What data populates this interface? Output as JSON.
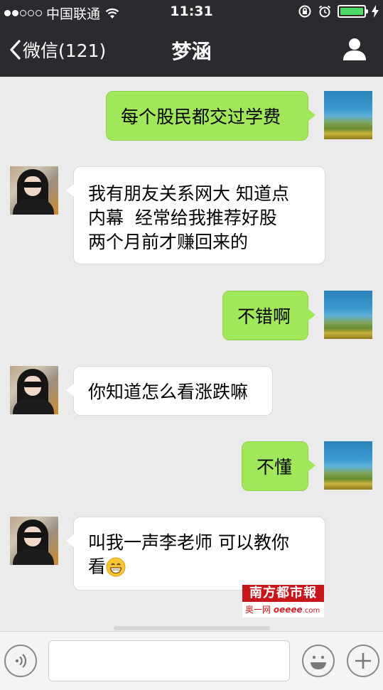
{
  "status_bar": {
    "carrier": "中国联通",
    "time": "11:31",
    "battery_level": 1.0,
    "icons": [
      "signal-dots-icon",
      "wifi-icon",
      "orientation-lock-icon",
      "alarm-icon",
      "battery-icon",
      "charging-bolt-icon"
    ]
  },
  "nav": {
    "back_label": "微信(121)",
    "title": "梦涵",
    "right_icon": "profile-icon"
  },
  "messages": [
    {
      "side": "right",
      "sender": "self",
      "text": "每个股民都交过学费"
    },
    {
      "side": "left",
      "sender": "other",
      "lines": [
        "我有朋友关系网大 知道点",
        "内幕  经常给我推荐好股",
        "两个月前才赚回来的"
      ]
    },
    {
      "side": "right",
      "sender": "self",
      "text": "不错啊"
    },
    {
      "side": "left",
      "sender": "other",
      "text": "你知道怎么看涨跌嘛"
    },
    {
      "side": "right",
      "sender": "self",
      "text": "不懂"
    },
    {
      "side": "left",
      "sender": "other",
      "lines": [
        "叫我一声李老师 可以教你",
        "看"
      ],
      "emoji": "grinning-face-emoji"
    }
  ],
  "watermark": {
    "name": "南方都市報",
    "line2_prefix": "奥一网",
    "line2_site": "oeeee",
    "line2_suffix": ".com"
  },
  "input_bar": {
    "value": "",
    "icons": [
      "voice-icon",
      "emoji-icon",
      "plus-icon"
    ]
  },
  "colors": {
    "header_bg": "#2b2b2f",
    "chat_bg": "#ebebeb",
    "self_bubble": "#a0e75a",
    "other_bubble": "#ffffff",
    "battery": "#4cd964",
    "watermark_red": "#c8161d"
  }
}
